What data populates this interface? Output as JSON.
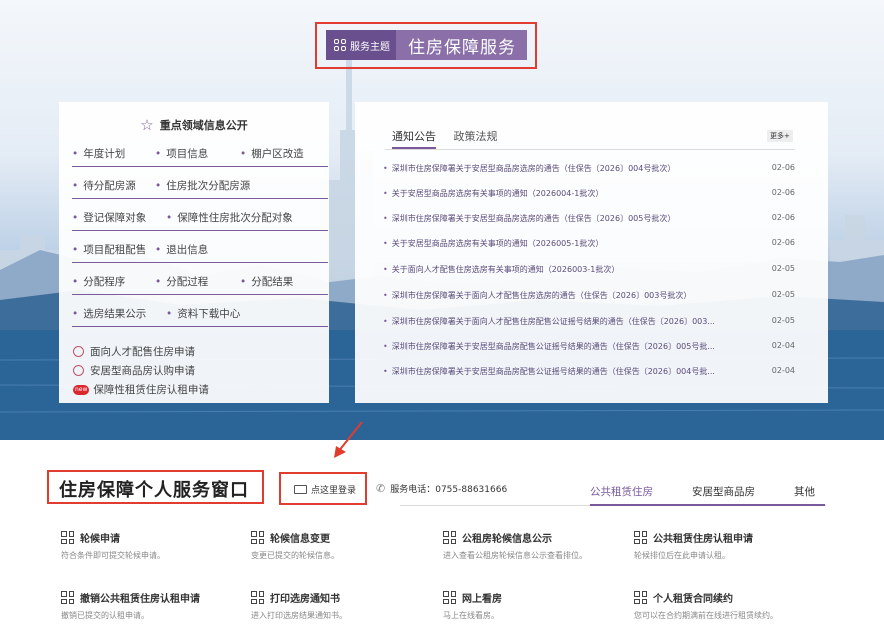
{
  "theme": {
    "tag_label": "服务主题",
    "title": "住房保障服务"
  },
  "key_info": {
    "heading": "重点领域信息公开",
    "rows": [
      [
        "年度计划",
        "项目信息",
        "棚户区改造"
      ],
      [
        "待分配房源",
        "住房批次分配房源"
      ],
      [
        "登记保障对象",
        "保障性住房批次分配对象"
      ],
      [
        "项目配租配售",
        "退出信息"
      ],
      [
        "分配程序",
        "分配过程",
        "分配结果"
      ],
      [
        "选房结果公示",
        "资料下载中心"
      ]
    ],
    "links": [
      {
        "label": "面向人才配售住房申请",
        "icon": "circle-icon"
      },
      {
        "label": "安居型商品房认购申请",
        "icon": "circle-icon"
      },
      {
        "label": "保障性租赁住房认租申请",
        "icon": "new-badge-icon",
        "badge": "new"
      }
    ]
  },
  "news": {
    "tabs": [
      "通知公告",
      "政策法规"
    ],
    "more": "更多+",
    "items": [
      {
        "title": "深圳市住房保障署关于安居型商品房选房的通告（住保告〔2026〕004号批次）",
        "date": "02-06"
      },
      {
        "title": "关于安居型商品房选房有关事项的通知（2026004-1批次）",
        "date": "02-06"
      },
      {
        "title": "深圳市住房保障署关于安居型商品房选房的通告（住保告〔2026〕005号批次）",
        "date": "02-06"
      },
      {
        "title": "关于安居型商品房选房有关事项的通知（2026005-1批次）",
        "date": "02-06"
      },
      {
        "title": "关于面向人才配售住房选房有关事项的通知（2026003-1批次）",
        "date": "02-05"
      },
      {
        "title": "深圳市住房保障署关于面向人才配售住房选房的通告（住保告〔2026〕003号批次）",
        "date": "02-05"
      },
      {
        "title": "深圳市住房保障署关于面向人才配售住房配售公证摇号结果的通告（住保告〔2026〕003...",
        "date": "02-05"
      },
      {
        "title": "深圳市住房保障署关于安居型商品房配售公证摇号结果的通告（住保告〔2026〕005号批...",
        "date": "02-04"
      },
      {
        "title": "深圳市住房保障署关于安居型商品房配售公证摇号结果的通告（住保告〔2026〕004号批...",
        "date": "02-04"
      }
    ]
  },
  "service": {
    "title": "住房保障个人服务窗口",
    "login": "点这里登录",
    "phone": "服务电话：0755-88631666",
    "tabs": [
      "公共租赁住房",
      "安居型商品房",
      "其他"
    ],
    "active_tab": "公共租赁住房",
    "cards": [
      {
        "title": "轮候申请",
        "desc": "符合条件即可提交轮候申请。"
      },
      {
        "title": "轮候信息变更",
        "desc": "变更已提交的轮候信息。"
      },
      {
        "title": "公租房轮候信息公示",
        "desc": "进入查看公租房轮候信息公示查看排位。"
      },
      {
        "title": "公共租赁住房认租申请",
        "desc": "轮候排位后在此申请认租。"
      },
      {
        "title": "撤销公共租赁住房认租申请",
        "desc": "撤销已提交的认租申请。"
      },
      {
        "title": "打印选房通知书",
        "desc": "进入打印选房结果通知书。"
      },
      {
        "title": "网上看房",
        "desc": "马上在线看房。"
      },
      {
        "title": "个人租赁合同续约",
        "desc": "您可以在合约期满前在线进行租赁续约。"
      }
    ]
  },
  "colors": {
    "accent": "#7a5a9c",
    "highlight_border": "#e03c2f"
  }
}
